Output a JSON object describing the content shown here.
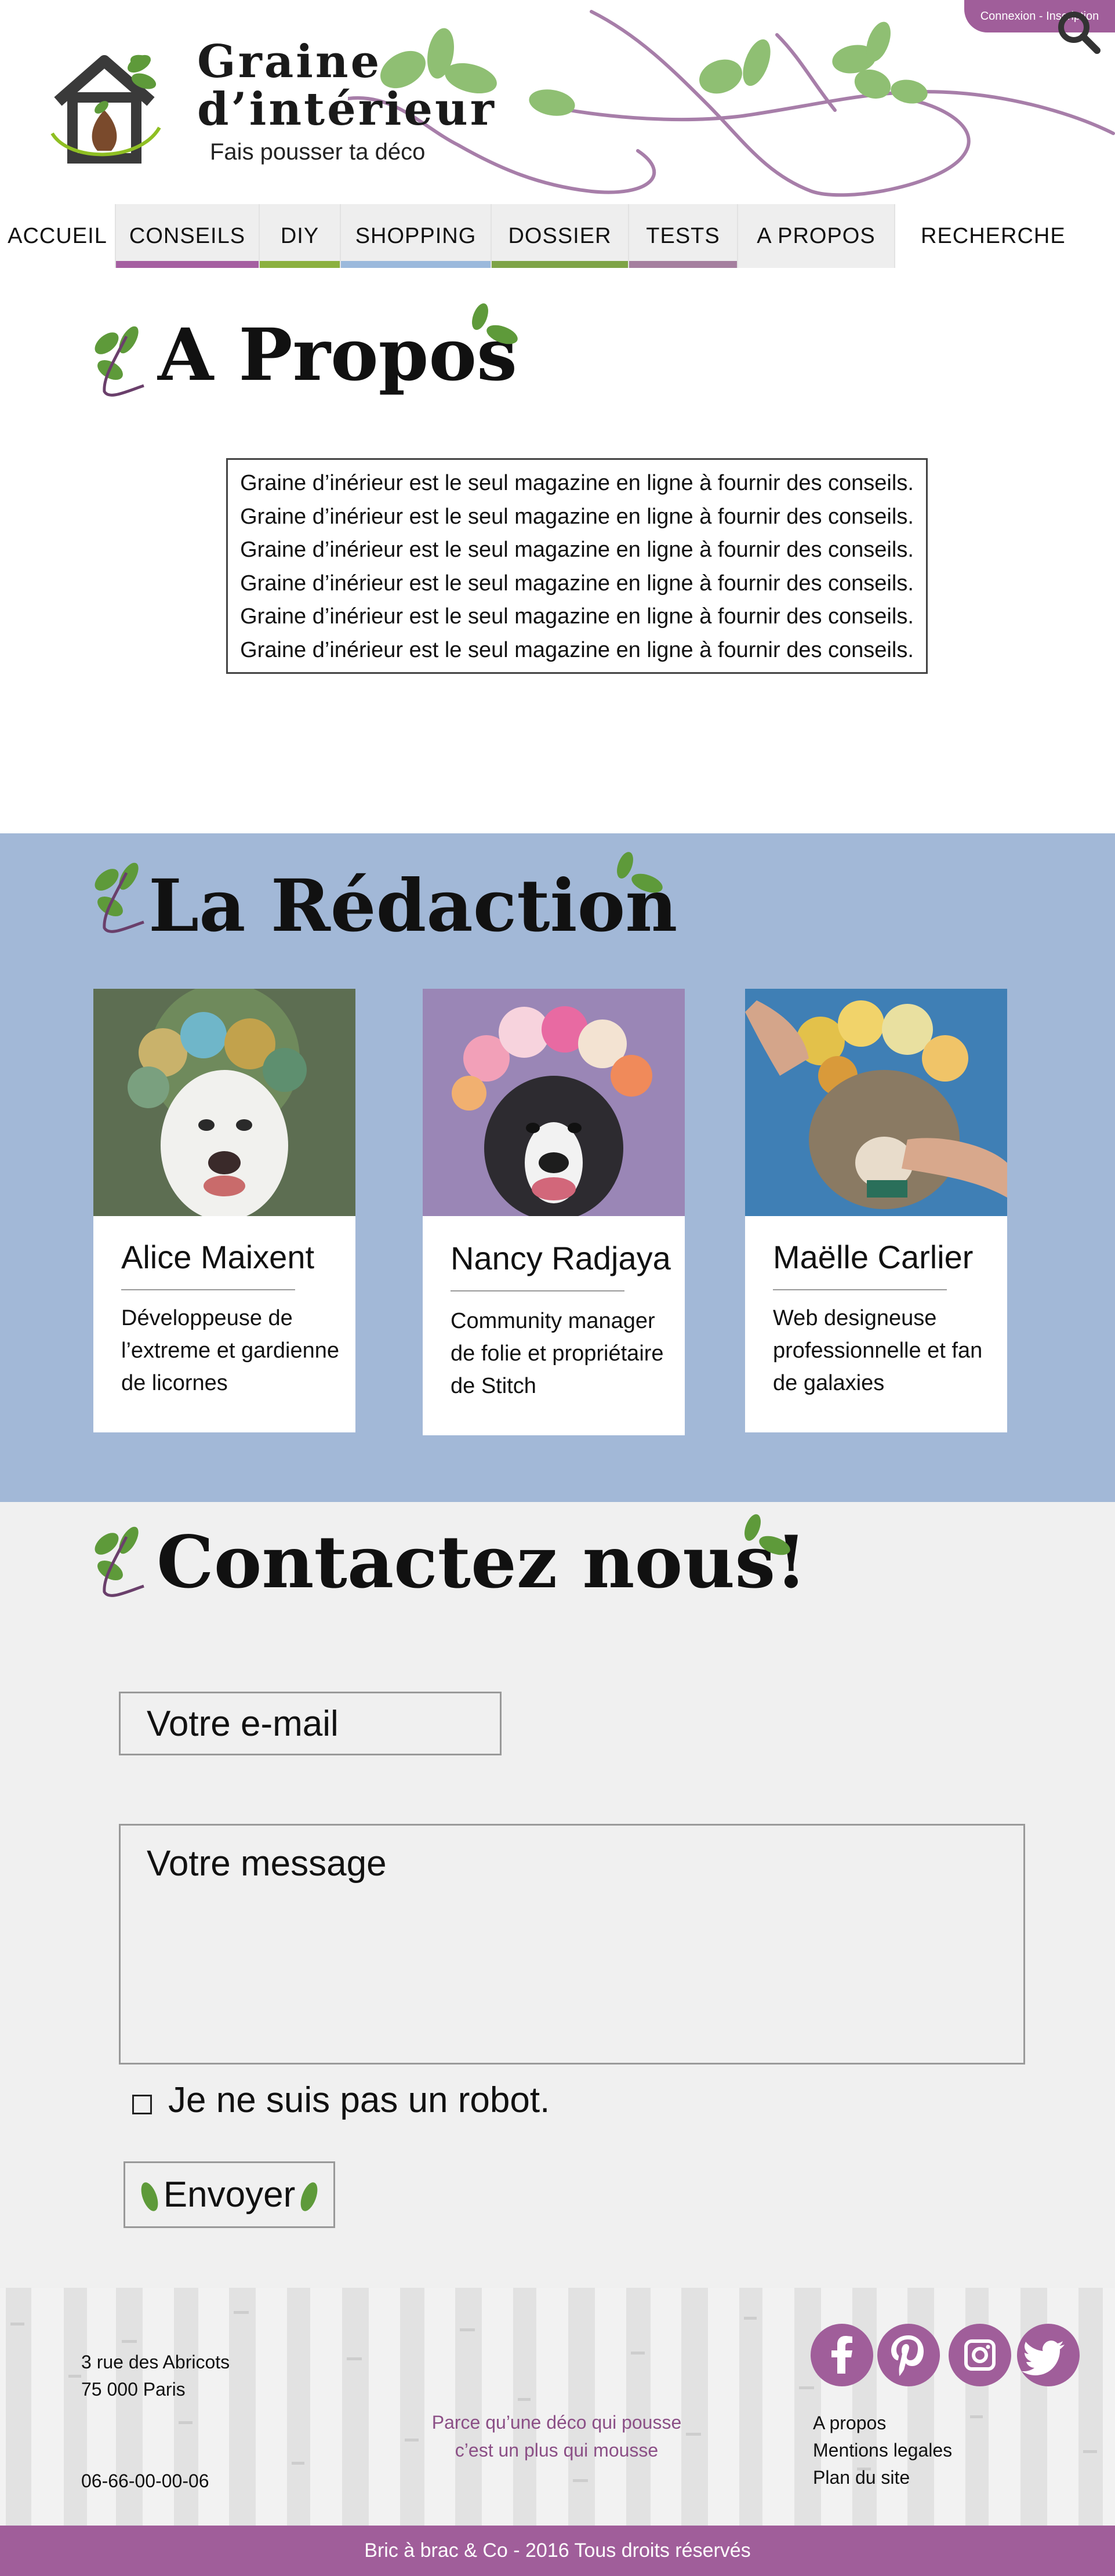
{
  "header": {
    "login_link": "Connexion - Inscription",
    "site_title": "Graine\nd’intérieur",
    "tagline": "Fais pousser ta déco"
  },
  "nav": {
    "items": [
      {
        "label": "ACCUEIL",
        "underline": ""
      },
      {
        "label": "CONSEILS",
        "underline": "#a55fa1"
      },
      {
        "label": "DIY",
        "underline": "#8bb13f"
      },
      {
        "label": "SHOPPING",
        "underline": "#9bb9dc"
      },
      {
        "label": "DOSSIER",
        "underline": "#7ea447"
      },
      {
        "label": "TESTS",
        "underline": "#a57f9f"
      },
      {
        "label": "A PROPOS",
        "underline": ""
      }
    ],
    "search_label": "RECHERCHE",
    "search_icon": "search-icon"
  },
  "about": {
    "title": "A Propos",
    "lines": [
      "Graine d’inérieur est le seul magazine en ligne à fournir des conseils.",
      "Graine d’inérieur est le seul magazine en ligne à fournir des conseils.",
      "Graine d’inérieur est le seul magazine en ligne à fournir des conseils.",
      "Graine d’inérieur est le seul magazine en ligne à fournir des conseils.",
      "Graine d’inérieur est le seul magazine en ligne à fournir des conseils.",
      "Graine d’inérieur est le seul magazine en ligne à fournir des conseils."
    ]
  },
  "redaction": {
    "title": "La Rédaction",
    "members": [
      {
        "name": "Alice Maixent",
        "desc": "Développeuse de l’extreme et gardienne de licornes"
      },
      {
        "name": "Nancy Radjaya",
        "desc": "Community manager de folie et propriétaire de Stitch"
      },
      {
        "name": "Maëlle Carlier",
        "desc": "Web designeuse professionnelle et fan de galaxies"
      }
    ]
  },
  "contact": {
    "title": "Contactez nous!",
    "email_placeholder": "Votre e-mail",
    "message_placeholder": "Votre message",
    "robot_label": "Je ne suis pas un robot.",
    "robot_checked": false,
    "send_label": "Envoyer"
  },
  "footer": {
    "address_line1": "3 rue des Abricots",
    "address_line2": "75 000 Paris",
    "phone": "06-66-00-00-06",
    "slogan_line1": "Parce qu’une déco qui pousse",
    "slogan_line2": "c’est un plus qui mousse",
    "links": [
      "A propos",
      "Mentions legales",
      "Plan du site"
    ],
    "social": [
      "facebook-icon",
      "pinterest-icon",
      "instagram-icon",
      "twitter-icon"
    ],
    "copyright": "Bric à brac & Co - 2016 Tous droits réservés"
  },
  "colors": {
    "accent_purple": "#a05e9a",
    "leaf_green": "#5e9a3a",
    "leaf_light": "#8fbf73",
    "redaction_bg": "#a2b8d7",
    "contact_bg": "#f0f0f0"
  }
}
